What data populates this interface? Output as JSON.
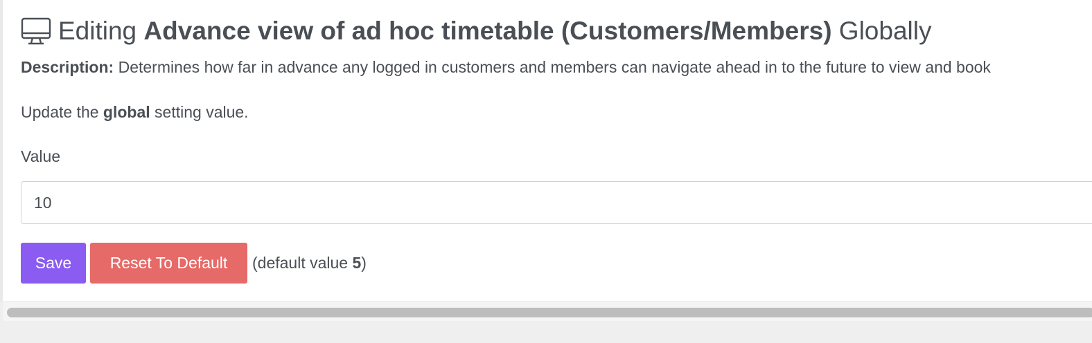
{
  "header": {
    "icon": "monitor-icon",
    "prefix": "Editing",
    "setting_name": "Advance view of ad hoc timetable (Customers/Members)",
    "suffix": "Globally"
  },
  "description": {
    "label": "Description:",
    "text": "Determines how far in advance any logged in customers and members can navigate ahead in to the future to view and book"
  },
  "update_line": {
    "before": "Update the",
    "scope": "global",
    "after": "setting value."
  },
  "form": {
    "value_label": "Value",
    "value": "10"
  },
  "actions": {
    "save_label": "Save",
    "reset_label": "Reset To Default",
    "default_note_before": "(default value",
    "default_value": "5",
    "default_note_after": ")"
  },
  "colors": {
    "save_button": "#8a5cf2",
    "reset_button": "#e66a67",
    "text": "#4a4f55"
  }
}
